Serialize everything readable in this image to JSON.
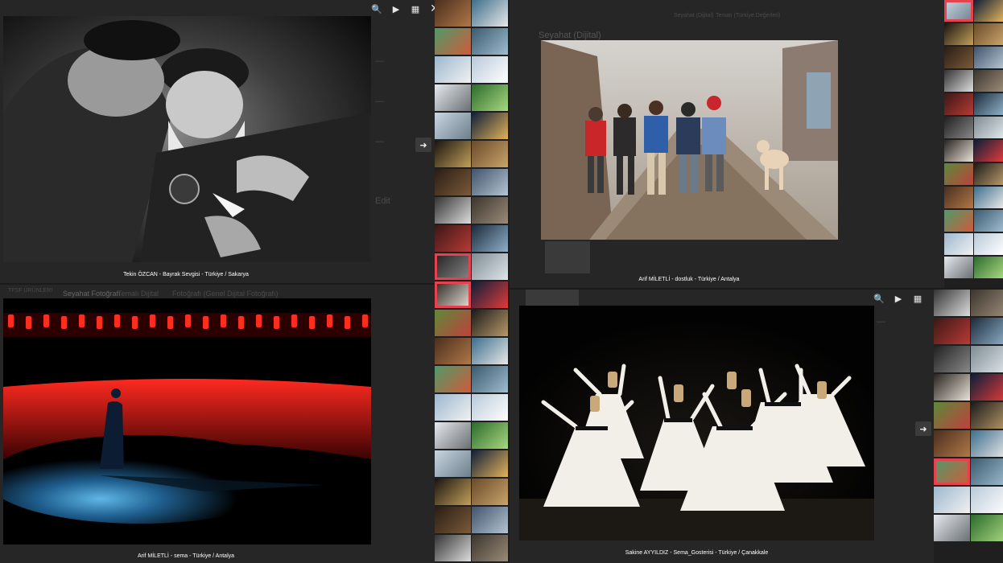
{
  "viewers": {
    "top_left": {
      "caption": "Tekin ÖZCAN - Bayrak Sevgisi - Türkiye / Sakarya"
    },
    "top_right": {
      "caption": "Arif MİLETLİ - dostluk - Türkiye / Antalya",
      "backdrop_title": "Seyahat (Dijital)",
      "backdrop_tabs": [
        "Seyahat (Dijital)",
        "Temalı (Türkiye Değerleri)"
      ]
    },
    "bottom_left": {
      "caption": "Arif MİLETLİ - sema - Türkiye / Antalya",
      "backdrop_tabs": [
        "Seyahat Fotoğrafı",
        "Temalı Dijital",
        "Fotoğrafı (Genel Dijital Fotoğrafı)"
      ],
      "backdrop_logo": "TFSF ÜRÜNLERİ"
    },
    "bottom_right": {
      "caption": "Sakine AYYILDIZ - Sema_Gosterisi - Türkiye / Çanakkale"
    }
  },
  "toolbar": {
    "zoom_icon": "🔍",
    "play_icon": "▶",
    "grid_icon": "▦",
    "close_icon": "✕",
    "next_icon": "➜"
  },
  "colors": {
    "selected_border": "#e6414f",
    "background": "#262626"
  }
}
